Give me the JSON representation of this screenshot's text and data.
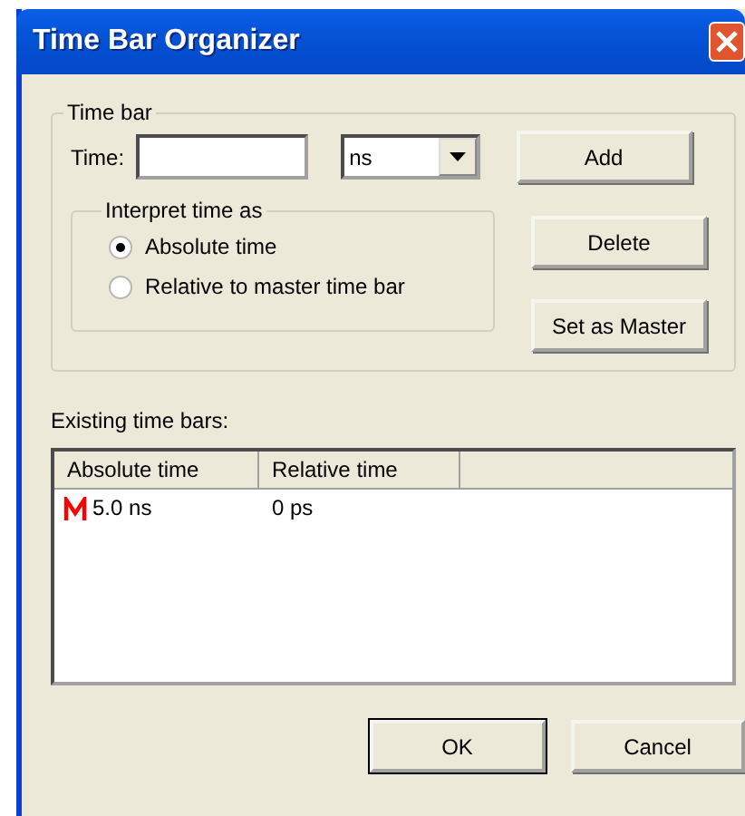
{
  "window": {
    "title": "Time Bar Organizer"
  },
  "time_bar": {
    "title": "Time bar",
    "time_label": "Time:",
    "unit": "ns",
    "interpret": {
      "title": "Interpret time as",
      "options": [
        {
          "label": "Absolute time",
          "selected": true
        },
        {
          "label": "Relative to master time bar",
          "selected": false
        }
      ]
    },
    "buttons": [
      "Add",
      "Delete",
      "Set as Master"
    ]
  },
  "existing": {
    "label": "Existing time bars:",
    "columns": [
      "Absolute time",
      "Relative time"
    ],
    "rows": [
      {
        "master": true,
        "cells": [
          "5.0 ns",
          "0 ps"
        ]
      }
    ]
  },
  "buttons": [
    "OK",
    "Cancel"
  ]
}
